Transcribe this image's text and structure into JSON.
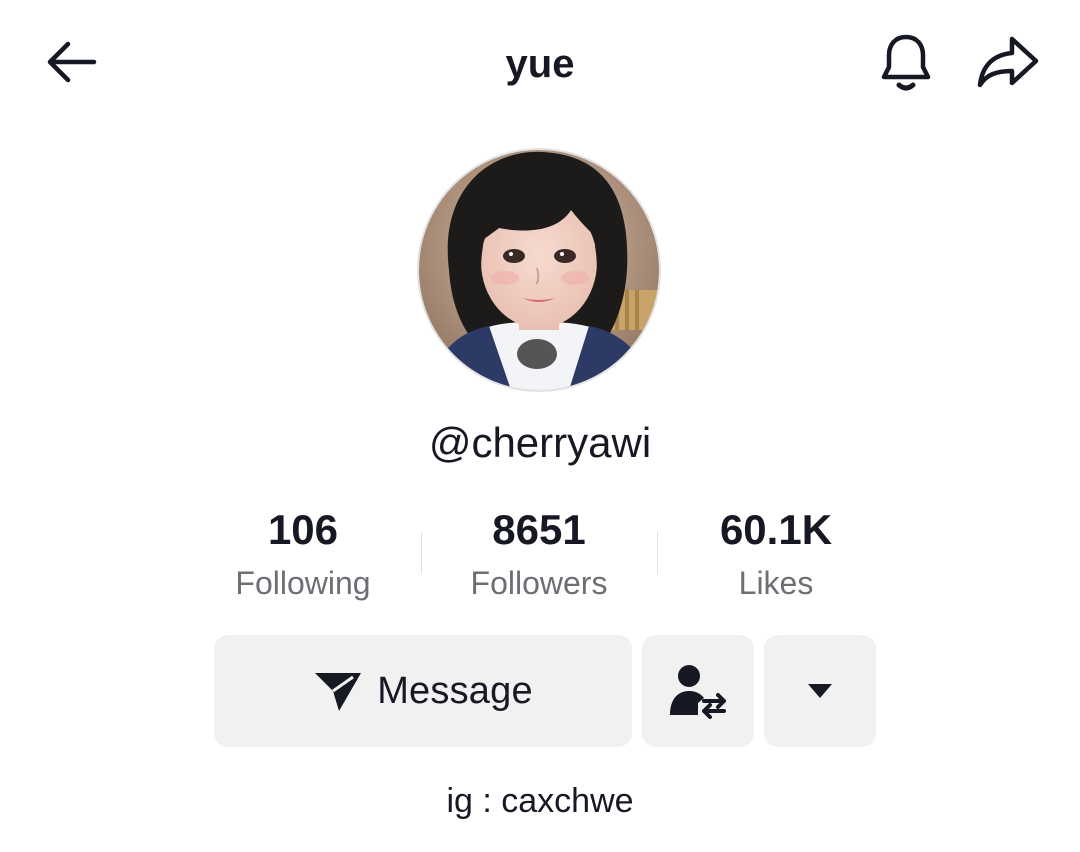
{
  "header": {
    "title": "yue",
    "back_icon": "arrow-left-icon",
    "bell_icon": "bell-icon",
    "share_icon": "share-arrow-icon"
  },
  "profile": {
    "avatar": "profile-photo",
    "handle": "@cherryawi",
    "bio": "ig : caxchwe"
  },
  "stats": [
    {
      "value": "106",
      "label": "Following"
    },
    {
      "value": "8651",
      "label": "Followers"
    },
    {
      "value": "60.1K",
      "label": "Likes"
    }
  ],
  "actions": {
    "message_label": "Message",
    "message_icon": "send-icon",
    "follow_toggle_icon": "person-swap-icon",
    "more_icon": "caret-down-icon"
  },
  "colors": {
    "text_primary": "#161823",
    "text_secondary": "#6e6f74",
    "button_bg": "#f1f1f2"
  }
}
